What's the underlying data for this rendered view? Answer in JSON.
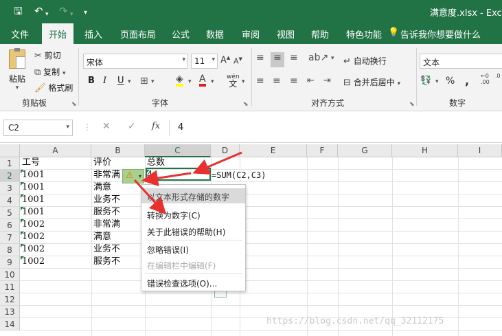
{
  "title": "满意度.xlsx  -  Exce",
  "qa_icons": [
    "save-icon",
    "undo-icon",
    "redo-icon",
    "customize-icon"
  ],
  "tabs": [
    "文件",
    "开始",
    "插入",
    "页面布局",
    "公式",
    "数据",
    "审阅",
    "视图",
    "帮助",
    "特色功能"
  ],
  "tell_me": "告诉我你想要做什么",
  "clipboard": {
    "paste": "粘贴",
    "cut": "剪切",
    "copy": "复制",
    "format_painter": "格式刷",
    "label": "剪贴板"
  },
  "font": {
    "name": "宋体",
    "size": "11",
    "bold": "B",
    "italic": "I",
    "underline": "U",
    "wen": "wén",
    "label": "字体"
  },
  "alignment": {
    "wrap": "自动换行",
    "merge": "合并后居中",
    "label": "对齐方式"
  },
  "number": {
    "format": "文本",
    "percent": "%",
    "comma": ",",
    "label": "数字"
  },
  "formula_bar": {
    "name_box": "C2",
    "cancel": "✕",
    "enter": "✓",
    "fx": "fx",
    "value": "4"
  },
  "columns": [
    "A",
    "B",
    "C",
    "D",
    "E",
    "F",
    "G",
    "H",
    "I"
  ],
  "rows": [
    "1",
    "2",
    "3",
    "4",
    "5",
    "6",
    "7",
    "8",
    "9",
    "10",
    "11",
    "12",
    "13",
    "14"
  ],
  "cells": {
    "A": [
      "工号",
      "1001",
      "1001",
      "1001",
      "1001",
      "1002",
      "1002",
      "1002",
      "1002"
    ],
    "B": [
      "评价",
      "非常满",
      "满意",
      "业务不",
      "服务不",
      "非常满",
      "满意",
      "业务不",
      "服务不"
    ],
    "C1": "总数",
    "C2": "4",
    "D2": "=SUM(C2,C3)"
  },
  "error_menu": {
    "header": "以文本形式存储的数字",
    "items": [
      "转换为数字(C)",
      "关于此错误的帮助(H)",
      "忽略错误(I)",
      "在编辑栏中编辑(F)",
      "错误检查选项(O)..."
    ]
  },
  "watermark": "https://blog.csdn.net/qq_32112175",
  "colors": {
    "accent": "#217346",
    "arrow": "#e8312f",
    "error_btn": "#a9d08e"
  }
}
